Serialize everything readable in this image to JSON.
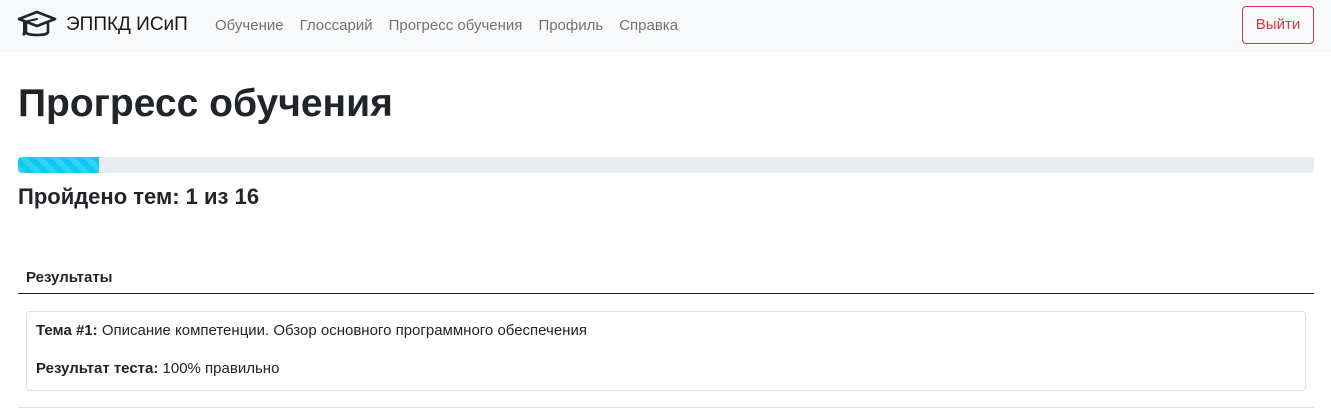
{
  "navbar": {
    "brand_text": "ЭППКД ИСиП",
    "brand_icon": "graduation-cap-icon",
    "links": [
      {
        "label": "Обучение"
      },
      {
        "label": "Глоссарий"
      },
      {
        "label": "Прогресс обучения"
      },
      {
        "label": "Профиль"
      },
      {
        "label": "Справка"
      }
    ],
    "logout_label": "Выйти"
  },
  "colors": {
    "navbar_bg": "#f8f9fa",
    "progress_fill": "#0dcaf0",
    "progress_track": "#e9ecef",
    "logout": "#dc3545"
  },
  "main": {
    "title": "Прогресс обучения",
    "progress": {
      "completed": 1,
      "total": 16,
      "fraction": 0.0625,
      "text": "Пройдено тем: 1 из 16"
    },
    "results": {
      "header": "Результаты",
      "items": [
        {
          "topic_label": "Тема #1:",
          "topic_text": " Описание компетенции. Обзор основного программного обеспечения",
          "result_label": "Результат теста:",
          "result_text": " 100% правильно"
        }
      ]
    }
  }
}
